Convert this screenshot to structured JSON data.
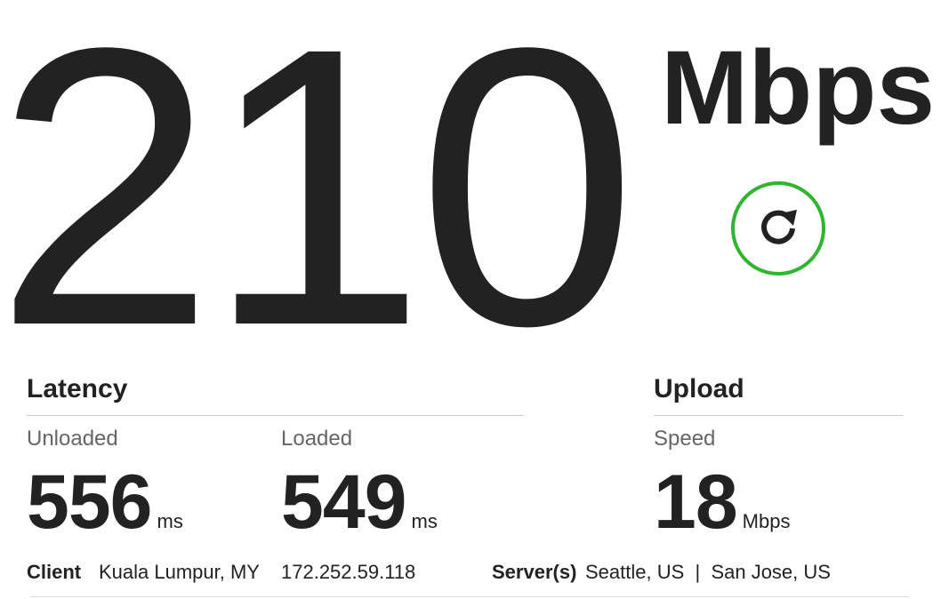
{
  "download": {
    "value": "210",
    "units": "Mbps"
  },
  "refresh": {
    "icon": "refresh-icon",
    "accent_color": "#2fb52f"
  },
  "latency": {
    "title": "Latency",
    "unloaded_label": "Unloaded",
    "unloaded_value": "556",
    "unloaded_unit": "ms",
    "loaded_label": "Loaded",
    "loaded_value": "549",
    "loaded_unit": "ms"
  },
  "upload": {
    "title": "Upload",
    "speed_label": "Speed",
    "speed_value": "18",
    "speed_unit": "Mbps"
  },
  "client": {
    "label": "Client",
    "location": "Kuala Lumpur, MY",
    "ip": "172.252.59.118"
  },
  "servers": {
    "label": "Server(s)",
    "list": "Seattle, US  |  San Jose, US"
  }
}
